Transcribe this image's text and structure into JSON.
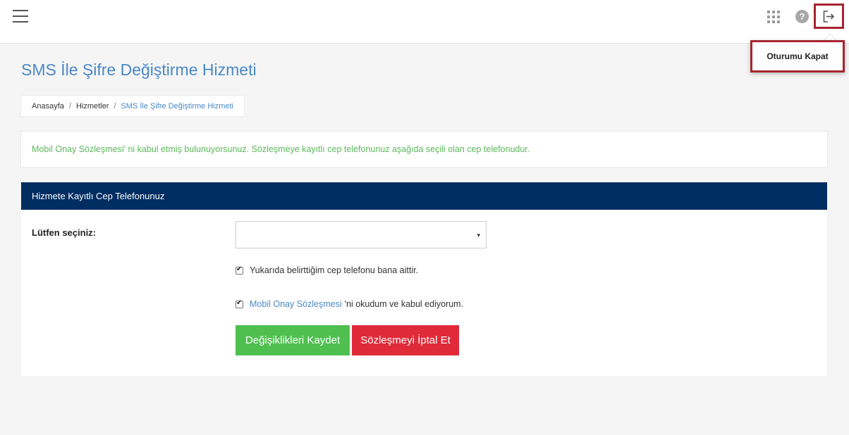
{
  "topbar": {
    "menu_icon": "hamburger-icon",
    "apps_icon": "grid-icon",
    "help_icon": "question-icon",
    "help_glyph": "?",
    "logout_icon": "logout-icon"
  },
  "dropdown": {
    "logout_label": "Oturumu Kapat"
  },
  "page": {
    "title": "SMS İle Şifre Değiştirme Hizmeti"
  },
  "breadcrumb": {
    "items": [
      "Anasayfa",
      "Hizmetler",
      "SMS İle Şifre Değiştirme Hizmeti"
    ],
    "separator": "/"
  },
  "info": {
    "message": "Mobil Onay Sözleşmesi' ni kabul etmiş bulunuyorsunuz. Sözleşmeye kayıtlı cep telefonunuz aşağıda seçili olan cep telefonudur."
  },
  "panel": {
    "header": "Hizmete Kayıtlı Cep Telefonunuz",
    "select_label": "Lütfen seçiniz:",
    "select_value": "",
    "caret": "▾",
    "check1_text": "Yukarıda belirttiğim cep telefonu bana aittir.",
    "check2_link": "Mobil Onay Sözleşmesi",
    "check2_text": "'ni okudum ve kabul ediyorum.",
    "save_label": "Değişiklikleri Kaydet",
    "cancel_label": "Sözleşmeyi İptal Et"
  },
  "colors": {
    "accent": "#4a88c6",
    "panel_header": "#002d62",
    "success": "#4fc04f",
    "danger": "#e02a3a",
    "highlight": "#a62530"
  }
}
